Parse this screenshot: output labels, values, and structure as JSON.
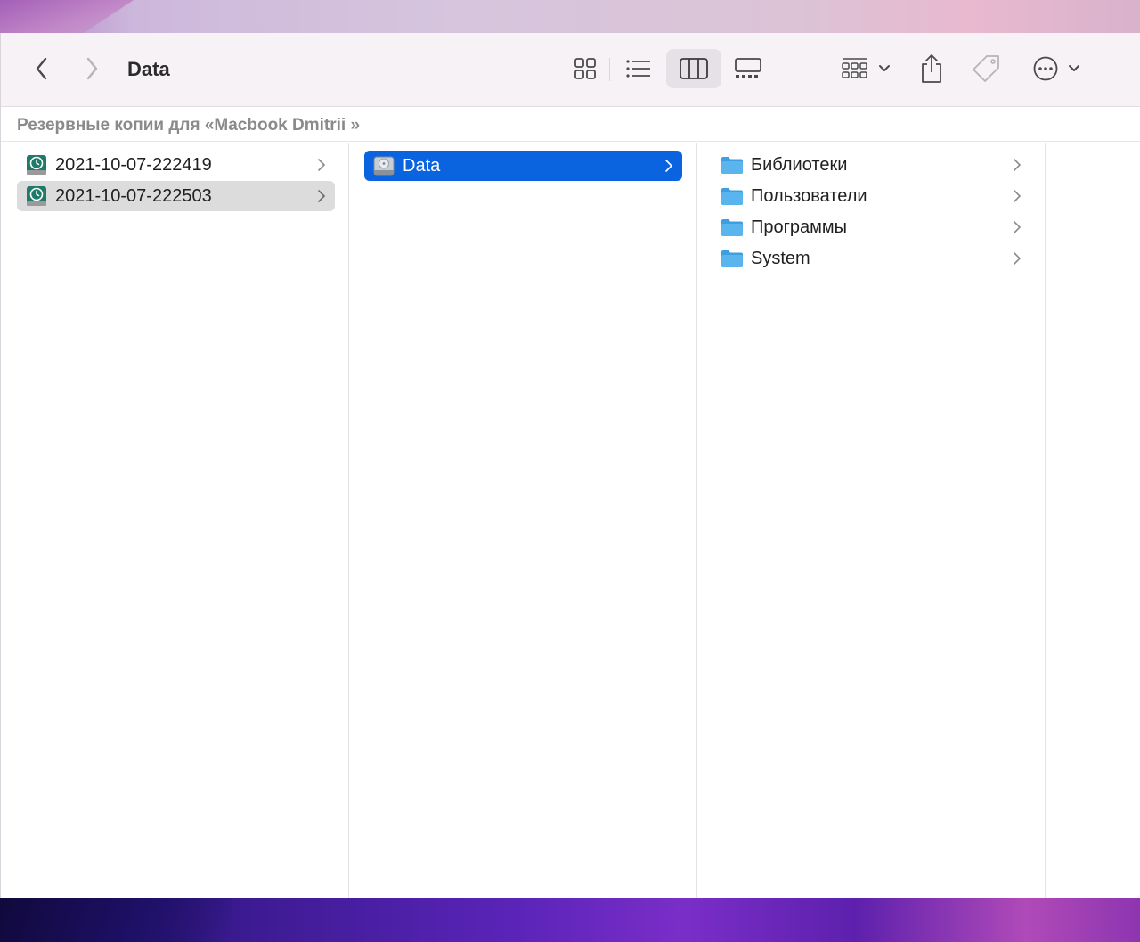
{
  "window": {
    "title": "Data"
  },
  "pathbar": {
    "text": "Резервные копии для «Macbook  Dmitrii »"
  },
  "columns": [
    {
      "items": [
        {
          "label": "2021-10-07-222419",
          "icon": "time-machine-backup-icon",
          "selected": false
        },
        {
          "label": "2021-10-07-222503",
          "icon": "time-machine-backup-icon",
          "selected": true
        }
      ]
    },
    {
      "items": [
        {
          "label": "Data",
          "icon": "hard-drive-icon",
          "selected": true
        }
      ]
    },
    {
      "items": [
        {
          "label": "Библиотеки",
          "icon": "folder-icon"
        },
        {
          "label": "Пользователи",
          "icon": "folder-icon"
        },
        {
          "label": "Программы",
          "icon": "folder-icon"
        },
        {
          "label": "System",
          "icon": "folder-icon"
        }
      ]
    }
  ],
  "colors": {
    "selection_blue": "#0A64E0",
    "selection_grey": "#DCDCDC",
    "folder_blue": "#5AB4EE"
  }
}
